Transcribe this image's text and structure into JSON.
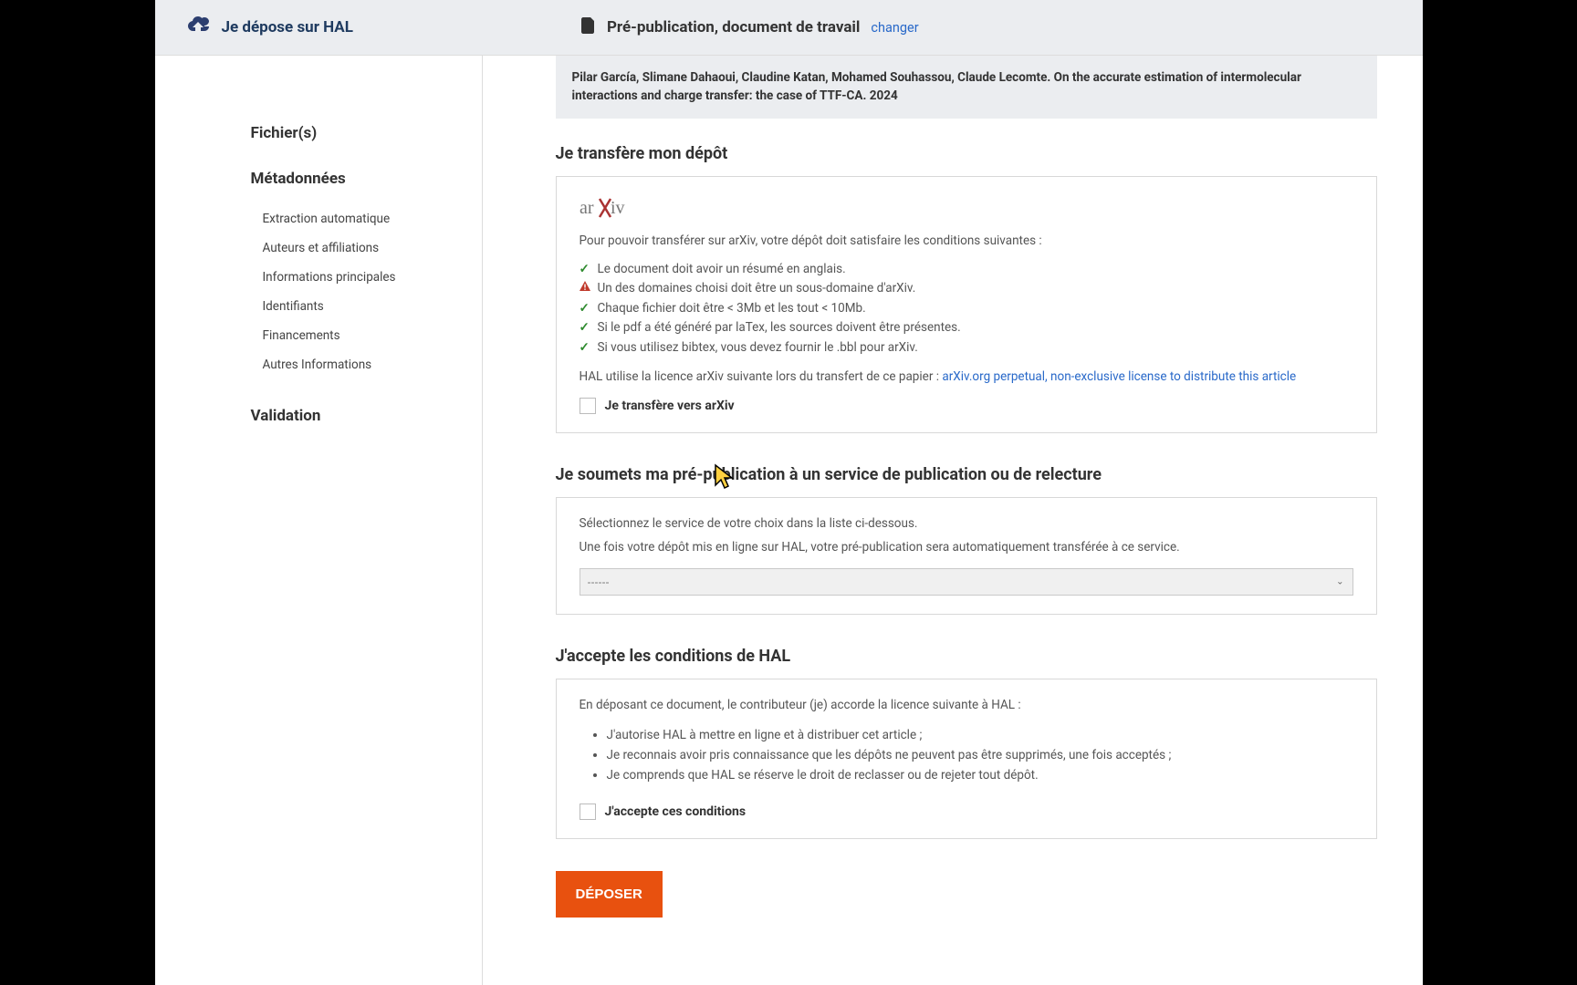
{
  "header": {
    "title": "Je dépose sur HAL",
    "doc_type": "Pré-publication, document de travail",
    "change": "changer"
  },
  "sidebar": {
    "files": "Fichier(s)",
    "metadata": "Métadonnées",
    "subitems": {
      "extraction": "Extraction automatique",
      "authors": "Auteurs et affiliations",
      "main_info": "Informations principales",
      "identifiers": "Identifiants",
      "funding": "Financements",
      "other": "Autres Informations"
    },
    "validation": "Validation"
  },
  "citation": "Pilar García, Slimane Dahaoui, Claudine Katan, Mohamed Souhassou, Claude Lecomte. On the accurate estimation of intermolecular interactions and charge transfer: the case of TTF-CA. 2024",
  "transfer": {
    "title": "Je transfère mon dépôt",
    "intro": "Pour pouvoir transférer sur arXiv, votre dépôt doit satisfaire les conditions suivantes :",
    "conditions": {
      "c1": "Le document doit avoir un résumé en anglais.",
      "c2": "Un des domaines choisi doit être un sous-domaine d'arXiv.",
      "c3": "Chaque fichier doit être < 3Mb et les tout < 10Mb.",
      "c4": "Si le pdf a été généré par laTex, les sources doivent être présentes.",
      "c5": "Si vous utilisez bibtex, vous devez fournir le .bbl pour arXiv."
    },
    "license_prefix": "HAL utilise la licence arXiv suivante lors du transfert de ce papier : ",
    "license_link": "arXiv.org perpetual, non-exclusive license to distribute this article",
    "checkbox_label": "Je transfère vers arXiv"
  },
  "service": {
    "title": "Je soumets ma pré-publication à un service de publication ou de relecture",
    "line1": "Sélectionnez le service de votre choix dans la liste ci-dessous.",
    "line2": "Une fois votre dépôt mis en ligne sur HAL, votre pré-publication sera automatiquement transférée à ce service.",
    "placeholder": "------"
  },
  "terms": {
    "title": "J'accepte les conditions de HAL",
    "intro": "En déposant ce document, le contributeur (je) accorde la licence suivante à HAL :",
    "items": {
      "t1": "J'autorise HAL à mettre en ligne et à distribuer cet article ;",
      "t2": "Je reconnais avoir pris connaissance que les dépôts ne peuvent pas être supprimés, une fois acceptés ;",
      "t3": "Je comprends que HAL se réserve le droit de reclasser ou de rejeter tout dépôt."
    },
    "checkbox_label": "J'accepte ces conditions"
  },
  "submit": "DÉPOSER"
}
